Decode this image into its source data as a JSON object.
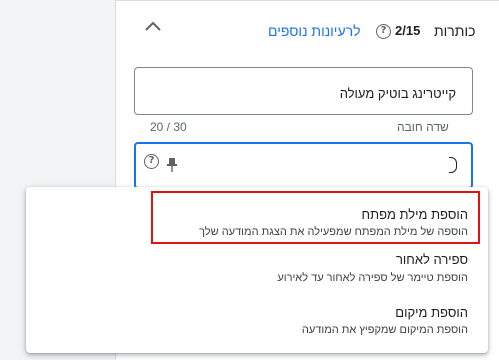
{
  "headlines": {
    "label": "כותרות",
    "count": "2/15",
    "help_glyph": "?",
    "ideas_link": "לרעיונות נוספים",
    "collapse_icon": "chevron-up-icon"
  },
  "field1": {
    "value": "קייטרינג בוטיק מעולה",
    "required": "שדה חובה",
    "counter": "20 / 30"
  },
  "field2": {
    "value": "",
    "help_glyph": "?",
    "pin_icon": "pin-icon"
  },
  "dropdown": {
    "options": [
      {
        "title": "הוספת מילת מפתח",
        "description": "הוספה של מילת המפתח שמפעילה את הצגת המודעה שלך"
      },
      {
        "title": "ספירה לאחור",
        "description": "הוספת טיימר של ספירה לאחור עד לאירוע"
      },
      {
        "title": "הוספת מיקום",
        "description": "הוספת המיקום שמקפיץ את המודעה"
      }
    ],
    "highlight_color": "#e01212"
  },
  "colors": {
    "accent": "#1a73e8",
    "text": "#202124",
    "muted": "#5f6368"
  }
}
